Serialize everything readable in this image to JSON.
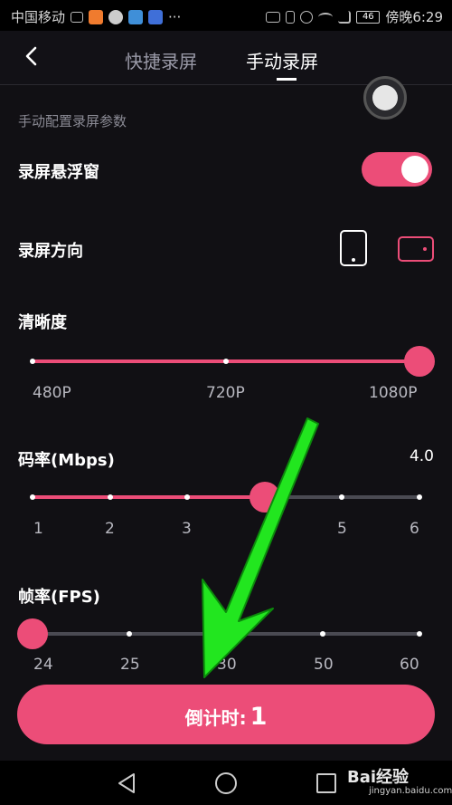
{
  "status_bar": {
    "carrier": "中国移动",
    "network": "46",
    "time": "傍晚6:29"
  },
  "header": {
    "tabs": [
      {
        "label": "快捷录屏",
        "active": false
      },
      {
        "label": "手动录屏",
        "active": true
      }
    ]
  },
  "section_label": "手动配置录屏参数",
  "floating_window": {
    "label": "录屏悬浮窗",
    "enabled": true
  },
  "orientation": {
    "label": "录屏方向",
    "options": [
      "portrait",
      "landscape"
    ],
    "selected": "landscape"
  },
  "resolution": {
    "label": "清晰度",
    "ticks": [
      "480P",
      "720P",
      "1080P"
    ],
    "selected_index": 2
  },
  "bitrate": {
    "label": "码率(Mbps)",
    "value": "4.0",
    "ticks": [
      "1",
      "2",
      "3",
      "5",
      "6"
    ],
    "level": 0.5
  },
  "framerate": {
    "label": "帧率(FPS)",
    "ticks": [
      "24",
      "25",
      "30",
      "50",
      "60"
    ],
    "selected_index": 0
  },
  "countdown_button": {
    "label": "倒计时:",
    "value": "1"
  },
  "watermark": {
    "text": "Bai经验",
    "sub": "jingyan.baidu.com"
  },
  "colors": {
    "accent": "#ec4d78",
    "annotation_arrow": "#22e61f"
  }
}
